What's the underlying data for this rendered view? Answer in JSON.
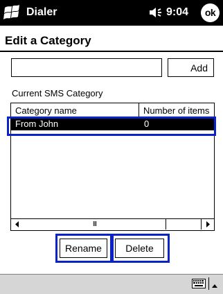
{
  "titlebar": {
    "app_title": "Dialer",
    "time": "9:04",
    "ok_label": "ok"
  },
  "page": {
    "title": "Edit a Category"
  },
  "form": {
    "input_value": "",
    "add_label": "Add"
  },
  "list": {
    "heading": "Current SMS Category",
    "columns": [
      "Category name",
      "Number of items"
    ],
    "rows": [
      {
        "name": "From John",
        "count": "0",
        "selected": true
      }
    ],
    "scroll_thumb_label": "III"
  },
  "buttons": {
    "rename_label": "Rename",
    "delete_label": "Delete"
  },
  "icons": {
    "start": "windows-flag-icon",
    "speaker": "speaker-icon",
    "keyboard": "keyboard-icon",
    "sip_arrow": "up-arrow-icon"
  },
  "colors": {
    "titlebar": "#000000",
    "selection": "#000000",
    "highlight_box": "#0a23c8",
    "menubar": "#d6d6d6"
  }
}
